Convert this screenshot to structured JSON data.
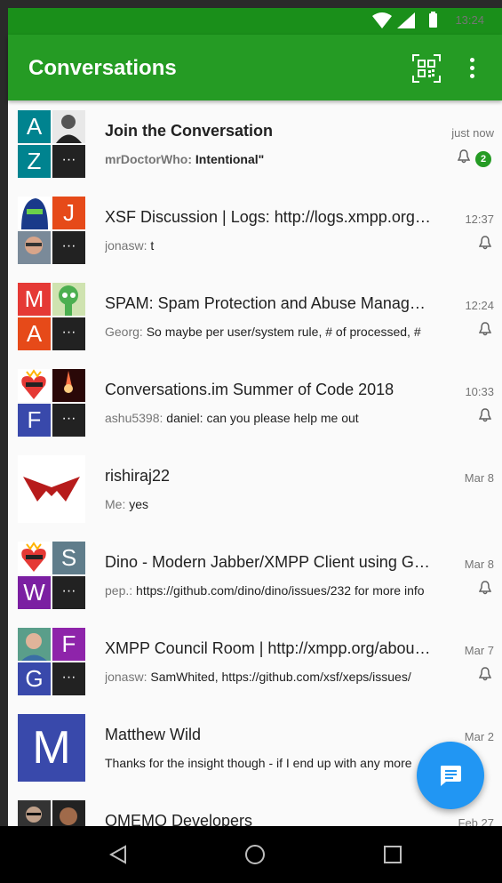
{
  "status_bar": {
    "time": "13:24"
  },
  "app_bar": {
    "title": "Conversations",
    "qr_icon": "qr-code-icon",
    "more_icon": "more-vert-icon"
  },
  "conversations": [
    {
      "name": "Join the Conversation",
      "time": "just now",
      "sender": "mrDoctorWho:",
      "message": "Intentional\"",
      "unread": "2",
      "avatar": {
        "tl": "A",
        "tr": "photo",
        "bl": "Z",
        "br": "···"
      }
    },
    {
      "name": "XSF Discussion | Logs: http://logs.xmpp.org/xsf/",
      "time": "12:37",
      "sender": "jonasw:",
      "message": "t",
      "avatar": {
        "tl": "photo",
        "tr": "J",
        "bl": "photo",
        "br": "···"
      }
    },
    {
      "name": "SPAM: Spam Protection and Abuse Management",
      "time": "12:24",
      "sender": "Georg:",
      "message": "So maybe per user/system rule, # of processed, #",
      "avatar": {
        "tl": "M",
        "tr": "photo",
        "bl": "A",
        "br": "···"
      }
    },
    {
      "name": "Conversations.im Summer of Code 2018",
      "time": "10:33",
      "sender": "ashu5398:",
      "message": "daniel: can you please help me out",
      "avatar": {
        "tl": "photo",
        "tr": "photo",
        "bl": "F",
        "br": "···"
      }
    },
    {
      "name": "rishiraj22",
      "time": "Mar 8",
      "sender": "Me:",
      "message": "yes",
      "avatar": {
        "full": "photo"
      }
    },
    {
      "name": "Dino - Modern Jabber/XMPP Client using GTK+/Vala",
      "time": "Mar 8",
      "sender": "pep.:",
      "message": "https://github.com/dino/dino/issues/232 for more info",
      "avatar": {
        "tl": "photo",
        "tr": "S",
        "bl": "W",
        "br": "···"
      }
    },
    {
      "name": "XMPP Council Room | http://xmpp.org/about-xmpp",
      "time": "Mar 7",
      "sender": "jonasw:",
      "message": "SamWhited, https://github.com/xsf/xeps/issues/",
      "avatar": {
        "tl": "photo",
        "tr": "F",
        "bl": "G",
        "br": "···"
      }
    },
    {
      "name": "Matthew Wild",
      "time": "Mar 2",
      "sender": "",
      "message": "Thanks for the insight though - if I end up with any more",
      "avatar": {
        "full": "M"
      }
    },
    {
      "name": "OMEMO Developers",
      "time": "Feb 27",
      "sender": "",
      "message": "",
      "avatar": {
        "tl": "photo",
        "tr": "photo"
      }
    }
  ],
  "fab": {
    "icon": "new-message-icon"
  },
  "colors": {
    "primary": "#259b24",
    "primary_dark": "#1a8f1a",
    "fab": "#2196f3"
  }
}
